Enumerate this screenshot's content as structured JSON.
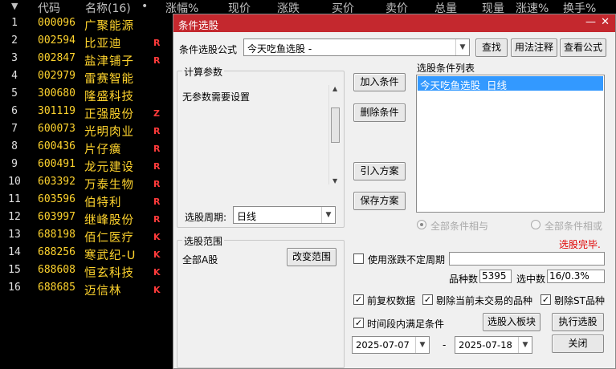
{
  "list": {
    "headers": [
      "代码",
      "名称(16)",
      "•",
      "涨幅%",
      "现价",
      "涨跌",
      "买价",
      "卖价",
      "总量",
      "现量",
      "涨速%",
      "换手%"
    ],
    "rows": [
      {
        "n": "1",
        "code": "000096",
        "name": "广聚能源",
        "flag": ""
      },
      {
        "n": "2",
        "code": "002594",
        "name": "比亚迪",
        "flag": "R"
      },
      {
        "n": "3",
        "code": "002847",
        "name": "盐津铺子",
        "flag": "R"
      },
      {
        "n": "4",
        "code": "002979",
        "name": "雷赛智能",
        "flag": ""
      },
      {
        "n": "5",
        "code": "300680",
        "name": "隆盛科技",
        "flag": ""
      },
      {
        "n": "6",
        "code": "301119",
        "name": "正强股份",
        "flag": "Z"
      },
      {
        "n": "7",
        "code": "600073",
        "name": "光明肉业",
        "flag": "R"
      },
      {
        "n": "8",
        "code": "600436",
        "name": "片仔癀",
        "flag": "R"
      },
      {
        "n": "9",
        "code": "600491",
        "name": "龙元建设",
        "flag": "R"
      },
      {
        "n": "10",
        "code": "603392",
        "name": "万泰生物",
        "flag": "R"
      },
      {
        "n": "11",
        "code": "603596",
        "name": "伯特利",
        "flag": "R"
      },
      {
        "n": "12",
        "code": "603997",
        "name": "继峰股份",
        "flag": "R"
      },
      {
        "n": "13",
        "code": "688198",
        "name": "佰仁医疗",
        "flag": "K"
      },
      {
        "n": "14",
        "code": "688256",
        "name": "寒武纪-U",
        "flag": "K"
      },
      {
        "n": "15",
        "code": "688608",
        "name": "恒玄科技",
        "flag": "K"
      },
      {
        "n": "16",
        "code": "688685",
        "name": "迈信林",
        "flag": "K"
      }
    ]
  },
  "dialog": {
    "title": "条件选股",
    "formula_label": "条件选股公式",
    "formula_value": "今天吃鱼选股 -",
    "find_btn": "查找",
    "usage_btn": "用法注释",
    "view_btn": "查看公式",
    "calc_group": "计算参数",
    "no_params": "无参数需要设置",
    "period_label": "选股周期:",
    "period_value": "日线",
    "add_btn": "加入条件",
    "del_btn": "删除条件",
    "import_btn": "引入方案",
    "save_btn": "保存方案",
    "cond_list_label": "选股条件列表",
    "cond_item": "今天吃鱼选股  日线",
    "radio_and": "全部条件相与",
    "radio_or": "全部条件相或",
    "status": "选股完毕.",
    "range_group": "选股范围",
    "range_value": "全部A股",
    "change_range_btn": "改变范围",
    "use_period_label": "使用涨跌不定周期",
    "count_label": "品种数",
    "count_value": "5395",
    "selected_label": "选中数",
    "selected_value": "16/0.3%",
    "fq_label": "前复权数据",
    "exclude_untraded_label": "剔除当前未交易的品种",
    "exclude_st_label": "剔除ST品种",
    "time_range_label": "时间段内满足条件",
    "to_block_btn": "选股入板块",
    "run_btn": "执行选股",
    "date_from": "2025-07-07",
    "date_sep": "-",
    "date_to": "2025-07-18",
    "close_btn": "关闭"
  },
  "colors": {
    "title_bar": "#c4282e",
    "flag_r": "#ff3b3b",
    "stock_text": "#ffd42e",
    "status_red": "#e00000",
    "selection": "#3399ff"
  }
}
